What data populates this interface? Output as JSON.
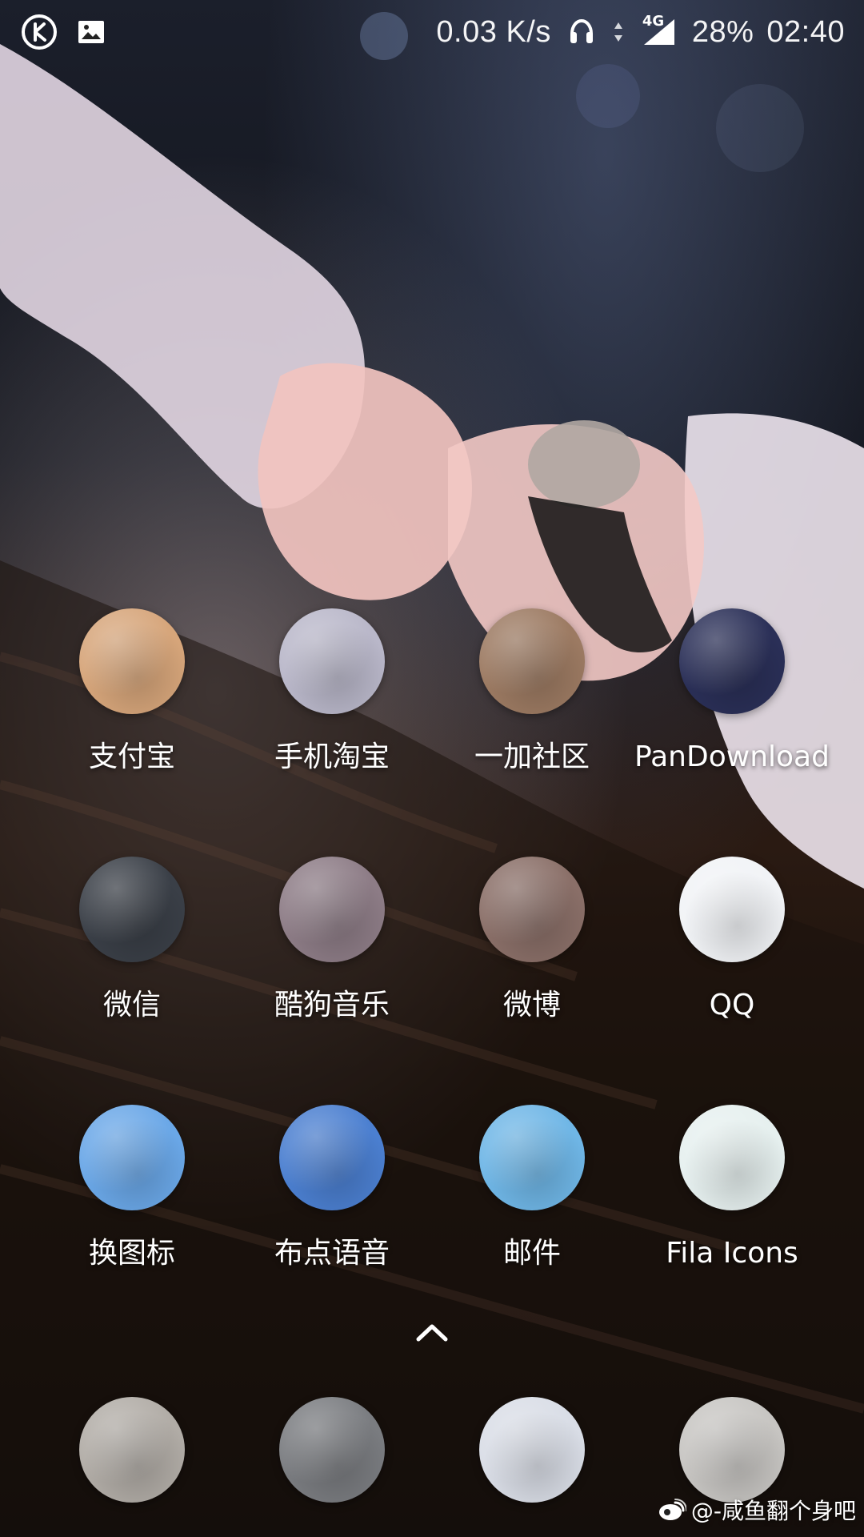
{
  "status_bar": {
    "network_speed": "0.03 K/s",
    "network_type": "4G",
    "battery": "28%",
    "time": "02:40",
    "icons": [
      "k-app-icon",
      "image-icon",
      "headphones-icon",
      "data-arrows-icon",
      "signal-icon"
    ]
  },
  "apps": {
    "row1": [
      {
        "label": "支付宝",
        "icon": "avatar-icon",
        "color": "#d6a57a"
      },
      {
        "label": "手机淘宝",
        "icon": "avatar-icon",
        "color": "#b9b7c9"
      },
      {
        "label": "一加社区",
        "icon": "avatar-icon",
        "color": "#9c7a62"
      },
      {
        "label": "PanDownload",
        "icon": "avatar-icon",
        "color": "#2a2f57"
      }
    ],
    "row2": [
      {
        "label": "微信",
        "icon": "avatar-icon",
        "color": "#3a3f47"
      },
      {
        "label": "酷狗音乐",
        "icon": "avatar-icon",
        "color": "#8d7c86"
      },
      {
        "label": "微博",
        "icon": "avatar-icon",
        "color": "#8a6f68"
      },
      {
        "label": "QQ",
        "icon": "avatar-icon",
        "color": "#f1f3f6"
      }
    ],
    "row3": [
      {
        "label": "换图标",
        "icon": "avatar-icon",
        "color": "#6aa7e7"
      },
      {
        "label": "布点语音",
        "icon": "avatar-icon",
        "color": "#4b7fd0"
      },
      {
        "label": "邮件",
        "icon": "avatar-icon",
        "color": "#6fb6e6"
      },
      {
        "label": "Fila Icons",
        "icon": "avatar-icon",
        "color": "#e6f0ef"
      }
    ]
  },
  "dock": {
    "apps": [
      {
        "icon": "avatar-icon",
        "color": "#b1aca6"
      },
      {
        "icon": "avatar-icon",
        "color": "#7a7c80"
      },
      {
        "icon": "avatar-icon",
        "color": "#d9dde6"
      },
      {
        "icon": "avatar-icon",
        "color": "#c7c5c2"
      }
    ]
  },
  "drawer": {
    "icon": "chevron-up-icon"
  },
  "watermark": {
    "text": "@-咸鱼翻个身吧",
    "icon": "weibo-icon"
  }
}
